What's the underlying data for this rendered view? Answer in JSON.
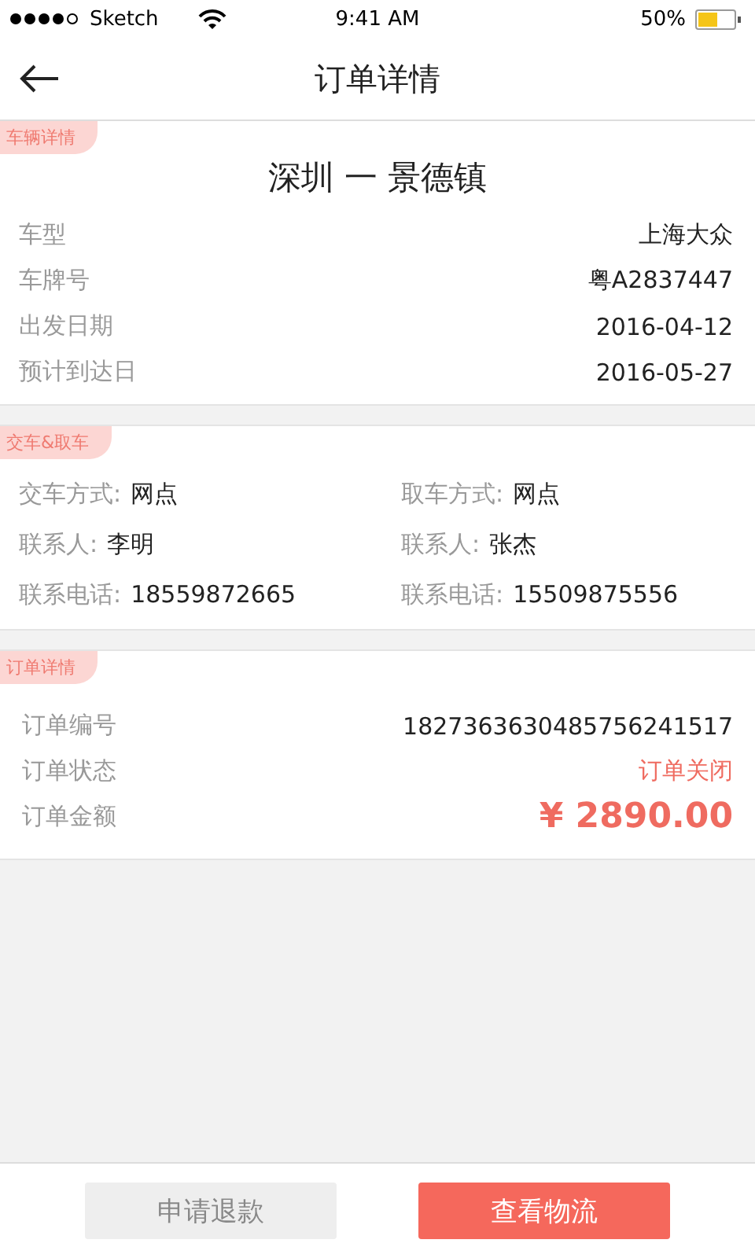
{
  "status_bar": {
    "carrier": "Sketch",
    "time": "9:41 AM",
    "battery": "50%"
  },
  "nav": {
    "title": "订单详情"
  },
  "vehicle": {
    "tag": "车辆详情",
    "route": "深圳 一 景德镇",
    "rows": [
      {
        "label": "车型",
        "value": "上海大众"
      },
      {
        "label": "车牌号",
        "value": "粤A2837447"
      },
      {
        "label": "出发日期",
        "value": "2016-04-12"
      },
      {
        "label": "预计到达日",
        "value": "2016-05-27"
      }
    ]
  },
  "handover": {
    "tag": "交车&取车",
    "rows": [
      [
        {
          "label": "交车方式:",
          "value": "网点"
        },
        {
          "label": "取车方式:",
          "value": "网点"
        }
      ],
      [
        {
          "label": "联系人:",
          "value": "李明"
        },
        {
          "label": "联系人:",
          "value": "张杰"
        }
      ],
      [
        {
          "label": "联系电话:",
          "value": "18559872665"
        },
        {
          "label": "联系电话:",
          "value": "15509875556"
        }
      ]
    ]
  },
  "order": {
    "tag": "订单详情",
    "rows": [
      {
        "label": "订单编号",
        "value": "1827363630485756241517",
        "kind": "plain"
      },
      {
        "label": "订单状态",
        "value": "订单关闭",
        "kind": "status"
      },
      {
        "label": "订单金额",
        "value": "¥ 2890.00",
        "kind": "amount"
      }
    ]
  },
  "buttons": [
    {
      "label": "申请退款",
      "kind": "secondary"
    },
    {
      "label": "查看物流",
      "kind": "primary"
    }
  ]
}
